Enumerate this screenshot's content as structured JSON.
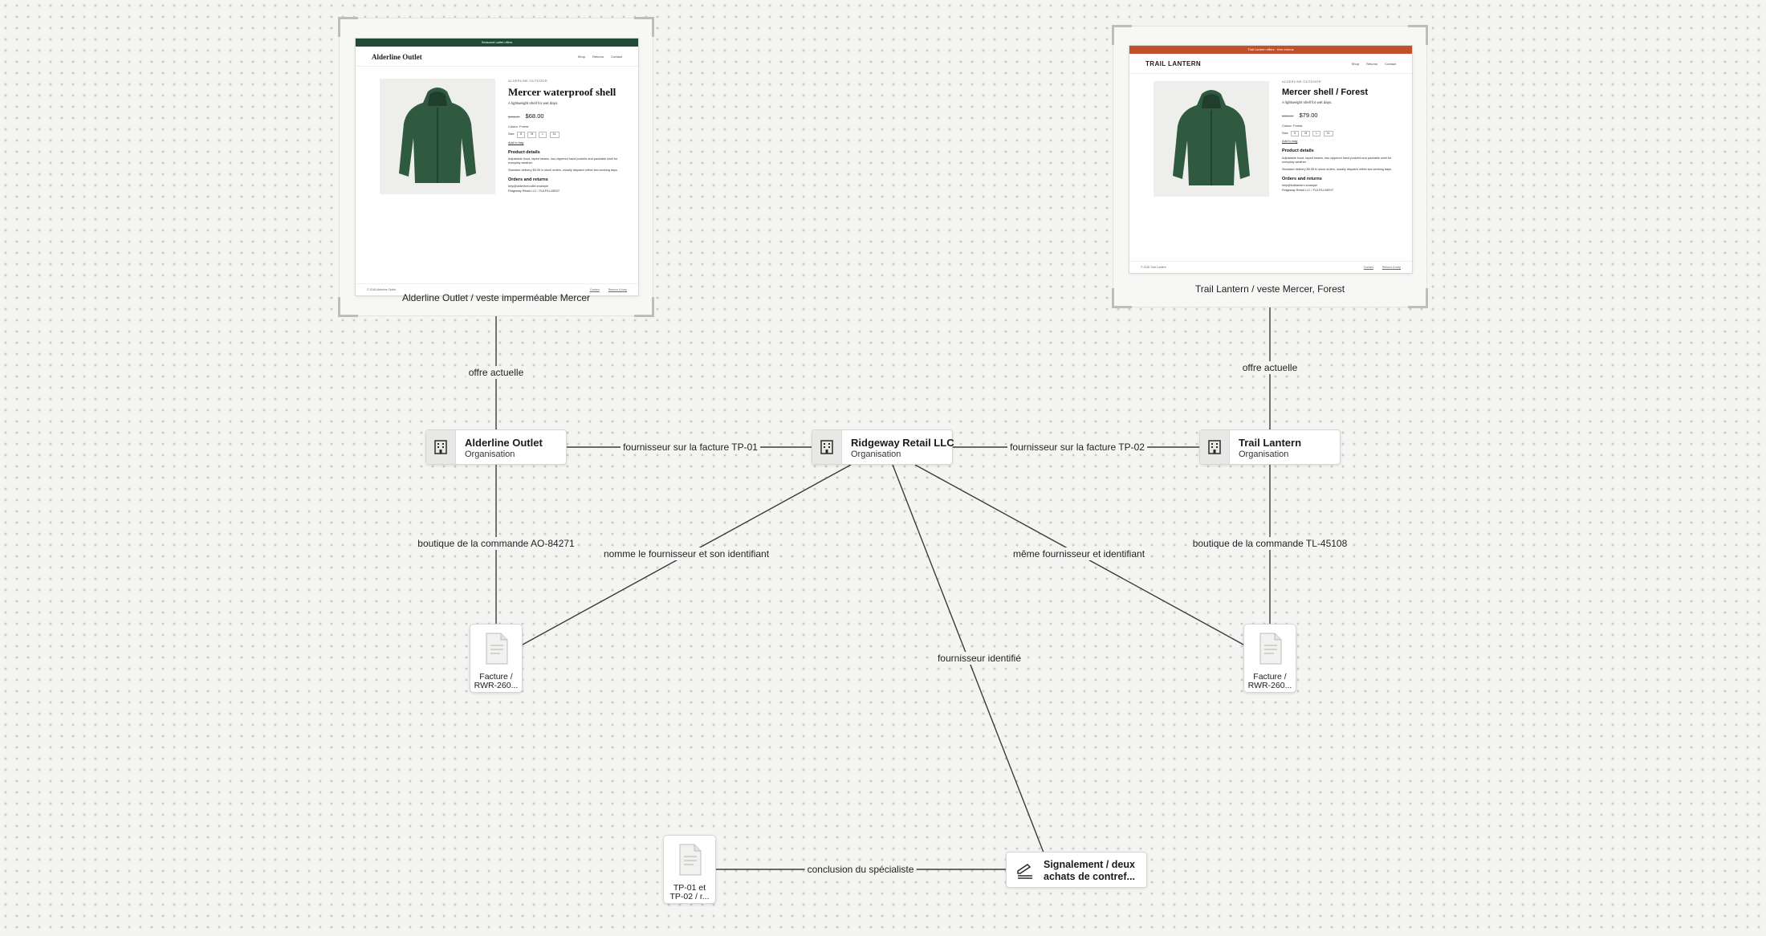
{
  "colors": {
    "alderline_banner": "#1f4a35",
    "trail_banner": "#c2502a",
    "jacket": "#2f5a40",
    "edge": "#3b3b3b"
  },
  "screenshots": [
    {
      "caption": "Alderline Outlet / veste imperméable Mercer",
      "page": {
        "banner": "Seasonal outlet offers",
        "logo": "Alderline Outlet",
        "nav": [
          "Shop",
          "Returns",
          "Contact"
        ],
        "brand": "ALDERLINE OUTDOOR",
        "title": "Mercer waterproof shell",
        "tagline": "A lightweight shell for wet days.",
        "old_price": "$156.00",
        "price": "$68.00",
        "colour": "Colour: Forest",
        "size_label": "Size",
        "sizes": [
          "S",
          "M",
          "L",
          "XL"
        ],
        "add_to_bag": "Add to bag",
        "details_heading": "Product details",
        "details_1": "Adjustable hood, taped seams, two zippered hand pockets and packable shell for everyday weather.",
        "details_2": "Standard delivery $5.95 in stock orders, usually dispatch within two working days.",
        "orders_heading": "Orders and returns",
        "orders_1": "help@alderlineoutlet.example",
        "orders_2": "Ridgeway Retail LLC / FULFILLMENT",
        "footer_left": "© 2026 Alderline Outlet",
        "footer_links": [
          "Contact",
          "Returns & help"
        ]
      }
    },
    {
      "caption": "Trail Lantern / veste Mercer, Forest",
      "page": {
        "banner": "Trail Lantern offers · free returns",
        "logo": "TRAIL LANTERN",
        "nav": [
          "Shop",
          "Returns",
          "Contact"
        ],
        "brand": "ALDERLINE OUTDOOR",
        "title": "Mercer shell / Forest",
        "tagline": "A lightweight shell for wet days.",
        "old_price": "$156.00",
        "price": "$79.00",
        "colour": "Colour: Forest",
        "size_label": "Size",
        "sizes": [
          "S",
          "M",
          "L",
          "XL"
        ],
        "add_to_bag": "Add to bag",
        "details_heading": "Product details",
        "details_1": "Adjustable hood, taped seams, two zippered hand pockets and packable shell for everyday weather.",
        "details_2": "Standard delivery $5.95 in stock orders, usually dispatch within two working days.",
        "orders_heading": "Orders and returns",
        "orders_1": "help@traillantern.example",
        "orders_2": "Ridgeway Retail LLC / FULFILLMENT",
        "footer_left": "© 2026 Trail Lantern",
        "footer_links": [
          "Contact",
          "Returns & help"
        ]
      }
    }
  ],
  "nodes": {
    "alderline": {
      "title": "Alderline Outlet",
      "subtitle": "Organisation",
      "icon": "building-icon"
    },
    "ridgeway": {
      "title": "Ridgeway Retail LLC",
      "subtitle": "Organisation",
      "icon": "building-icon"
    },
    "trail": {
      "title": "Trail Lantern",
      "subtitle": "Organisation",
      "icon": "building-icon"
    },
    "invoice_1": {
      "label_line1": "Facture /",
      "label_line2": "RWR-260...",
      "icon": "document-icon"
    },
    "invoice_2": {
      "label_line1": "Facture /",
      "label_line2": "RWR-260...",
      "icon": "document-icon"
    },
    "specialist": {
      "label_line1": "TP-01 et",
      "label_line2": "TP-02 / r...",
      "icon": "document-icon"
    },
    "report": {
      "label_line1": "Signalement / deux",
      "label_line2": "achats de contref...",
      "icon": "signature-icon"
    }
  },
  "edges": {
    "offer_alderline": "offre actuelle",
    "offer_trail": "offre actuelle",
    "supplier_tp01": "fournisseur sur la facture TP-01",
    "supplier_tp02": "fournisseur sur la facture TP-02",
    "shop_ao": "boutique de la commande AO-84271",
    "shop_tl": "boutique de la commande TL-45108",
    "names_supplier": "nomme le fournisseur et son identifiant",
    "same_supplier": "même fournisseur et identifiant",
    "identified_supplier": "fournisseur identifié",
    "specialist_conclusion": "conclusion du spécialiste"
  }
}
